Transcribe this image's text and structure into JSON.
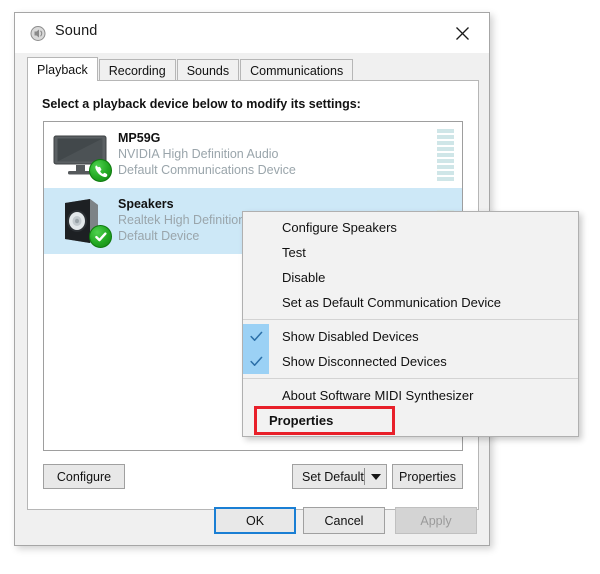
{
  "window": {
    "title": "Sound",
    "icon": "sound-speaker-icon",
    "close_label": "✕"
  },
  "tabs": [
    {
      "label": "Playback",
      "active": true
    },
    {
      "label": "Recording",
      "active": false
    },
    {
      "label": "Sounds",
      "active": false
    },
    {
      "label": "Communications",
      "active": false
    }
  ],
  "page": {
    "hint": "Select a playback device below to modify its settings:"
  },
  "devices": [
    {
      "name": "MP59G",
      "driver": "NVIDIA High Definition Audio",
      "status": "Default Communications Device",
      "icon": "monitor-icon",
      "badge": "phone-badge-icon",
      "selected": false,
      "meter_segments": 9
    },
    {
      "name": "Speakers",
      "driver": "Realtek High Definition Audio",
      "status": "Default Device",
      "icon": "speaker-icon",
      "badge": "check-badge-icon",
      "selected": true,
      "meter_segments": 4
    }
  ],
  "device_buttons": {
    "configure": "Configure",
    "set_default": "Set Default",
    "set_default_arrow": "dropdown-arrow-icon",
    "properties": "Properties"
  },
  "footer": {
    "ok": "OK",
    "cancel": "Cancel",
    "apply": "Apply"
  },
  "context_menu": {
    "items": [
      {
        "label": "Configure Speakers",
        "checked": false,
        "bold": false,
        "highlighted": false
      },
      {
        "label": "Test",
        "checked": false,
        "bold": false,
        "highlighted": false
      },
      {
        "label": "Disable",
        "checked": false,
        "bold": false,
        "highlighted": false
      },
      {
        "label": "Set as Default Communication Device",
        "checked": false,
        "bold": false,
        "highlighted": false
      },
      {
        "separator": true
      },
      {
        "label": "Show Disabled Devices",
        "checked": true,
        "bold": false,
        "highlighted": false
      },
      {
        "label": "Show Disconnected Devices",
        "checked": true,
        "bold": false,
        "highlighted": false
      },
      {
        "separator": true
      },
      {
        "label": "About Software MIDI Synthesizer",
        "checked": false,
        "bold": false,
        "highlighted": false
      },
      {
        "label": "Properties",
        "checked": false,
        "bold": true,
        "highlighted": true
      }
    ]
  },
  "colors": {
    "selection_blue": "#cde8f7",
    "check_gutter_blue": "#9bd1f5",
    "focus_blue": "#1a7fd4",
    "highlight_red": "#e8202a",
    "badge_green": "#22a822",
    "meter_teal": "#cfe6e8",
    "muted_text": "#9aa5ab"
  }
}
